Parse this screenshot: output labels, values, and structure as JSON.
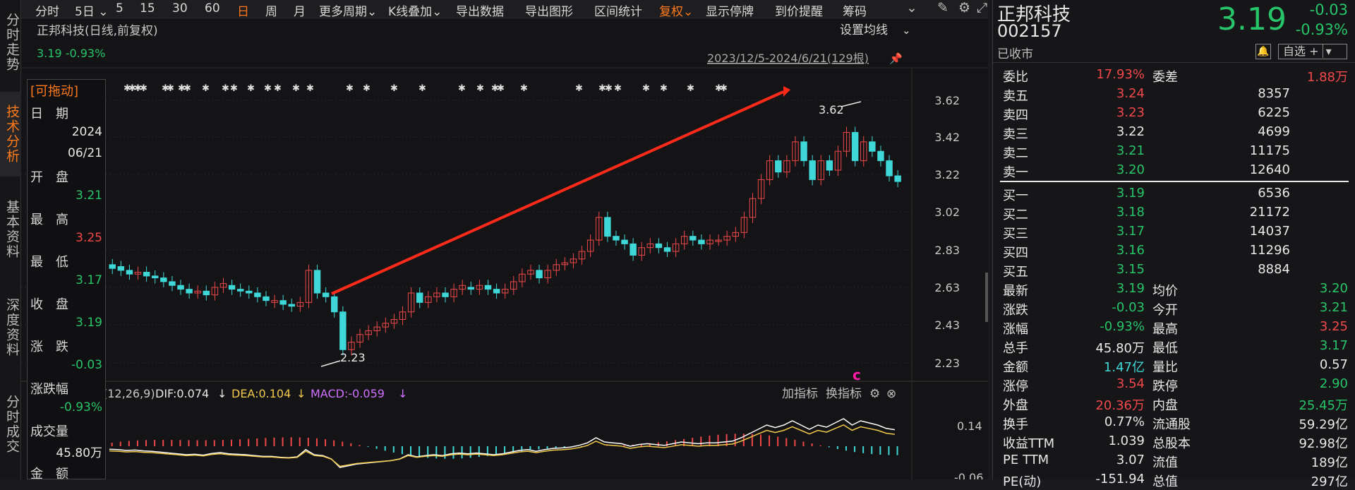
{
  "left_tabs": [
    "分时走势",
    "技术分析",
    "基本资料",
    "深度资料",
    "分时成交"
  ],
  "toolbar": {
    "items": [
      "分时",
      "5日",
      "5",
      "15",
      "30",
      "60",
      "日",
      "周",
      "月",
      "更多周期",
      "K线叠加",
      "导出数据",
      "导出图形",
      "区间统计",
      "复权",
      "显示停牌",
      "到价提醒",
      "筹码"
    ],
    "active": "日"
  },
  "chart": {
    "title": "正邦科技(日线,前复权)",
    "ma_setting": "设置均线",
    "last_line": "3.19 -0.93%",
    "range": "2023/12/5-2024/6/21(129根)",
    "y_ticks": [
      "3.62",
      "3.42",
      "3.22",
      "3.02",
      "2.83",
      "2.63",
      "2.43",
      "2.23"
    ],
    "high_label": "3.62",
    "low_label": "2.23",
    "marker_c": "c",
    "macd_label": "(12,26,9)",
    "macd": {
      "dif": "DIF:0.074",
      "dea": "DEA:0.104",
      "macd": "MACD:-0.059"
    },
    "macd_ticks": [
      "0.14",
      "-0.06"
    ],
    "add_indicator": "加指标",
    "switch_indicator": "换指标",
    "colors": {
      "up": "#f0484a",
      "down": "#3fd7d7",
      "dif": "#ffffff",
      "dea": "#f2c94c",
      "arrow": "#ff2a1a"
    }
  },
  "info_panel": {
    "title": "[可拖动]",
    "date_label": "日　期",
    "date_year": "2024",
    "date_md": "06/21",
    "rows": [
      {
        "label": "开　盘",
        "value": "3.21",
        "color": "green"
      },
      {
        "label": "最　高",
        "value": "3.25",
        "color": "red"
      },
      {
        "label": "最　低",
        "value": "3.17",
        "color": "green"
      },
      {
        "label": "收　盘",
        "value": "3.19",
        "color": "green"
      },
      {
        "label": "涨　跌",
        "value": "-0.03",
        "color": "green"
      },
      {
        "label": "涨跌幅",
        "value": "-0.93%",
        "color": "green"
      },
      {
        "label": "成交量",
        "value": "45.80万",
        "color": "white"
      },
      {
        "label": "金　额",
        "value": "",
        "color": "white"
      }
    ]
  },
  "quote": {
    "name": "正邦科技",
    "code": "002157",
    "status": "已收市",
    "price": "3.19",
    "change": "-0.03",
    "change_pct": "-0.93%",
    "watch": "自选 +",
    "weibi_label": "委比",
    "weibi": "17.93%",
    "weicha_label": "委差",
    "weicha": "1.88万",
    "sells": [
      {
        "label": "卖五",
        "price": "3.24",
        "vol": "8357",
        "color": "red"
      },
      {
        "label": "卖四",
        "price": "3.23",
        "vol": "6225",
        "color": "red"
      },
      {
        "label": "卖三",
        "price": "3.22",
        "vol": "4699",
        "color": "white"
      },
      {
        "label": "卖二",
        "price": "3.21",
        "vol": "11175",
        "color": "green"
      },
      {
        "label": "卖一",
        "price": "3.20",
        "vol": "12640",
        "color": "green"
      }
    ],
    "buys": [
      {
        "label": "买一",
        "price": "3.19",
        "vol": "6536",
        "color": "green"
      },
      {
        "label": "买二",
        "price": "3.18",
        "vol": "21172",
        "color": "green"
      },
      {
        "label": "买三",
        "price": "3.17",
        "vol": "14037",
        "color": "green"
      },
      {
        "label": "买四",
        "price": "3.16",
        "vol": "11296",
        "color": "green"
      },
      {
        "label": "买五",
        "price": "3.15",
        "vol": "8884",
        "color": "green"
      }
    ],
    "stats": [
      {
        "l1": "最新",
        "v1": "3.19",
        "c1": "green",
        "l2": "均价",
        "v2": "3.20",
        "c2": "green"
      },
      {
        "l1": "涨跌",
        "v1": "-0.03",
        "c1": "green",
        "l2": "今开",
        "v2": "3.21",
        "c2": "green"
      },
      {
        "l1": "涨幅",
        "v1": "-0.93%",
        "c1": "green",
        "l2": "最高",
        "v2": "3.25",
        "c2": "red"
      },
      {
        "l1": "总手",
        "v1": "45.80万",
        "c1": "white",
        "l2": "最低",
        "v2": "3.17",
        "c2": "green"
      },
      {
        "l1": "金额",
        "v1": "1.47亿",
        "c1": "cyan",
        "l2": "量比",
        "v2": "0.57",
        "c2": "white"
      },
      {
        "l1": "涨停",
        "v1": "3.54",
        "c1": "red",
        "l2": "跌停",
        "v2": "2.90",
        "c2": "green"
      },
      {
        "l1": "外盘",
        "v1": "20.36万",
        "c1": "red",
        "l2": "内盘",
        "v2": "25.45万",
        "c2": "green"
      },
      {
        "l1": "换手",
        "v1": "0.77%",
        "c1": "white",
        "l2": "流通股",
        "v2": "59.29亿",
        "c2": "white"
      },
      {
        "l1": "收益TTM",
        "v1": "1.039",
        "c1": "white",
        "l2": "总股本",
        "v2": "92.98亿",
        "c2": "white"
      },
      {
        "l1": "PE TTM",
        "v1": "3.07",
        "c1": "white",
        "l2": "流值",
        "v2": "189亿",
        "c2": "white"
      },
      {
        "l1": "PE(动)",
        "v1": "-151.94",
        "c1": "white",
        "l2": "总值",
        "v2": "297亿",
        "c2": "white"
      }
    ]
  }
}
